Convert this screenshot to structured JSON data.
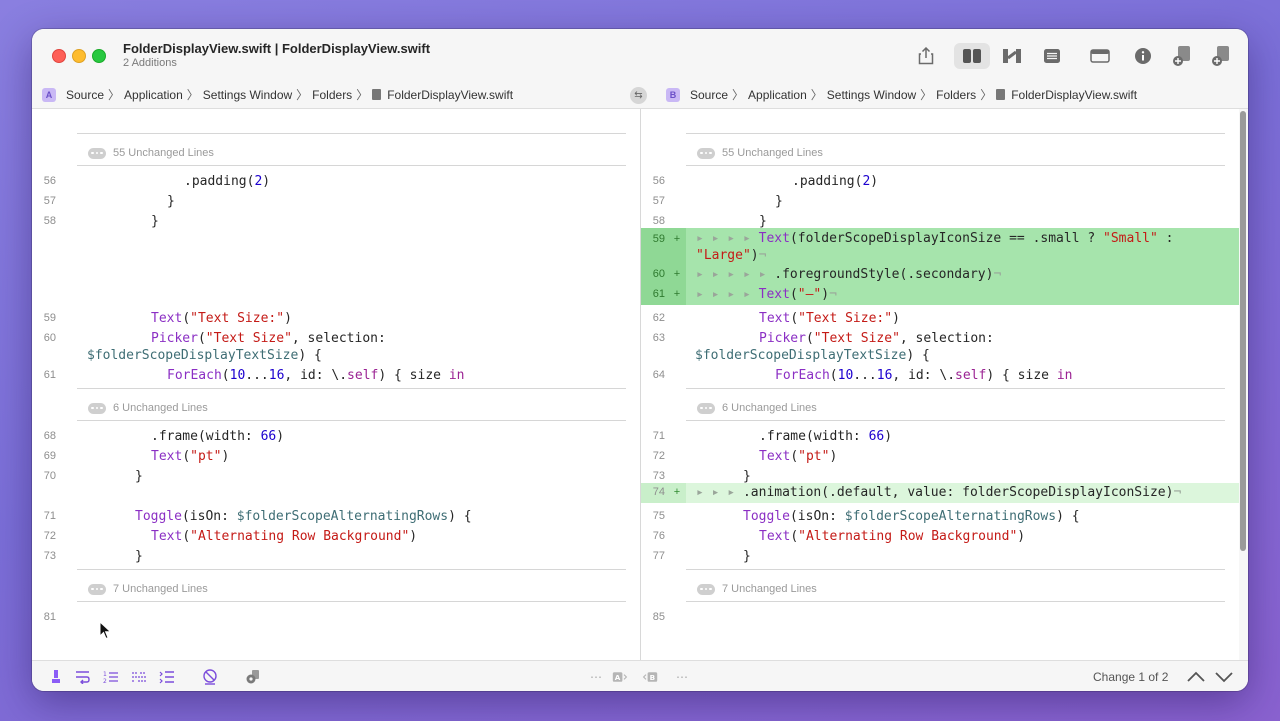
{
  "window": {
    "title": "FolderDisplayView.swift | FolderDisplayView.swift",
    "subtitle": "2 Additions"
  },
  "toolbar": {
    "icons": [
      "share-icon",
      "side-by-side-icon",
      "unified-diff-icon",
      "list-icon",
      "window-icon",
      "info-icon",
      "add-left-icon",
      "add-right-icon"
    ]
  },
  "path_a": {
    "badge": "A",
    "items": [
      "Source",
      "Application",
      "Settings Window",
      "Folders",
      "FolderDisplayView.swift"
    ]
  },
  "path_b": {
    "badge": "B",
    "items": [
      "Source",
      "Application",
      "Settings Window",
      "Folders",
      "FolderDisplayView.swift"
    ]
  },
  "folds": {
    "f1": "55 Unchanged Lines",
    "f2": "6 Unchanged Lines",
    "f3": "7 Unchanged Lines"
  },
  "left_lines": {
    "l56": "56",
    "l57": "57",
    "l58": "58",
    "l59": "59",
    "l60": "60",
    "l61": "61",
    "l68": "68",
    "l69": "69",
    "l70": "70",
    "l71": "71",
    "l72": "72",
    "l73": "73",
    "l81": "81"
  },
  "right_lines": {
    "l56": "56",
    "l57": "57",
    "l58": "58",
    "l59": "59",
    "l60": "60",
    "l61": "61",
    "l62": "62",
    "l63": "63",
    "l64": "64",
    "l71": "71",
    "l72": "72",
    "l73": "73",
    "l74": "74",
    "l75": "75",
    "l76": "76",
    "l77": "77",
    "l85": "85"
  },
  "code": {
    "padding": ".padding(",
    "padding_num": "2",
    "padding_end": ")",
    "brace": "}",
    "text_fn": "Text",
    "textsize_str": "\"Text Size:\"",
    "picker_fn": "Picker",
    "picker_str": "\"Text Size\"",
    "picker_mid": ", selection:",
    "picker_var": "$folderScopeDisplayTextSize",
    "picker_end": ") {",
    "foreach_fn": "ForEach",
    "foreach_open": "(",
    "foreach_num1": "10",
    "foreach_range": "...",
    "foreach_num2": "16",
    "foreach_mid": ", id: \\.",
    "foreach_self": "self",
    "foreach_end": ") { size ",
    "kw_in": "in",
    "frame": ".frame(width: ",
    "frame_num": "66",
    "frame_end": ")",
    "pt_str": "\"pt\"",
    "toggle_fn": "Toggle",
    "toggle_mid": "(isOn: ",
    "toggle_var": "$folderScopeAlternatingRows",
    "toggle_end": ") {",
    "alt_str": "\"Alternating Row Background\"",
    "paren_open": "(",
    "paren_close": ")",
    "add59_ws": "▸ ▸ ▸ ▸ ",
    "add59_code": "(folderScopeDisplayIconSize == .small ? ",
    "add59_small": "\"Small\"",
    "add59_colon": " :",
    "add59_large": "\"Large\"",
    "add59_close": ")",
    "eol": "¬",
    "add60_ws": "▸ ▸ ▸ ▸ ▸ ",
    "add60_code": ".foregroundStyle(.secondary)",
    "add61_ws": "▸ ▸ ▸ ▸ ",
    "add61_str": "\"–\"",
    "add74_ws": "▸ ▸ ▸ ",
    "add74_code": ".animation(.default, value: folderScopeDisplayIconSize)",
    "plus": "+"
  },
  "bottombar": {
    "change_label": "Change 1 of 2",
    "icons": [
      "highlight-icon",
      "wrap-icon",
      "line-numbers-icon",
      "whitespace-icon",
      "indent-icon",
      "hide-icon",
      "settings-icon",
      "left-a-icon",
      "right-b-icon",
      "previous-change-icon",
      "next-change-icon"
    ]
  }
}
